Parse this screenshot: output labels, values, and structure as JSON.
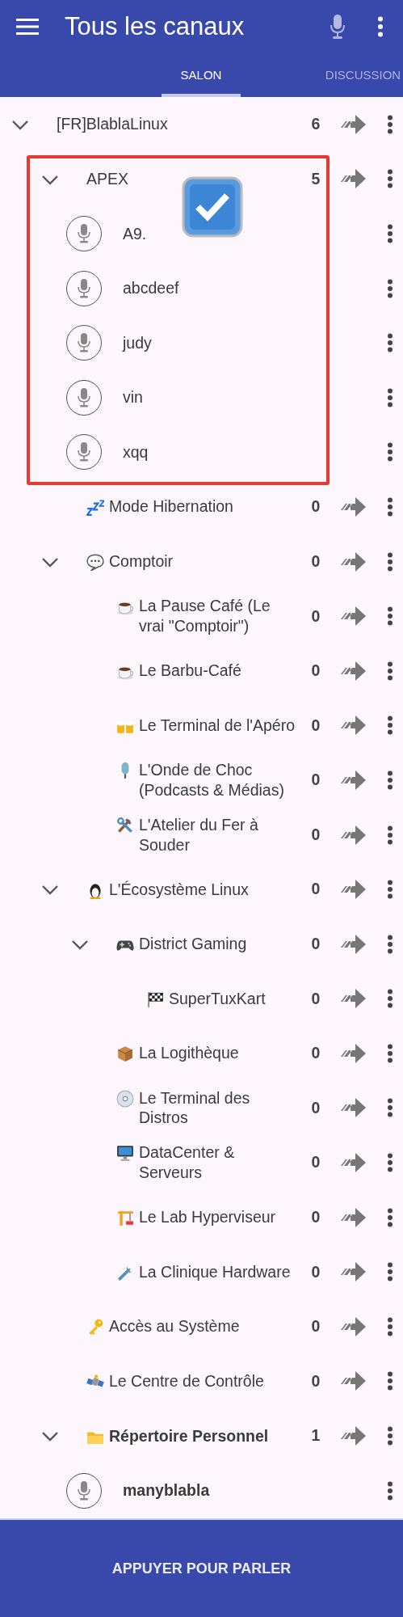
{
  "app_bar": {
    "title": "Tous les canaux",
    "mic_enabled": false
  },
  "tabs": [
    {
      "label": "SALON",
      "selected": true
    },
    {
      "label": "DISCUSSION",
      "selected": false
    }
  ],
  "channels": [
    {
      "kind": "channel",
      "name": "[FR]BlablaLinux",
      "count": "6",
      "expanded": true,
      "children": [
        {
          "kind": "channel",
          "name": "APEX",
          "count": "5",
          "expanded": true,
          "annotated": true,
          "children": [
            {
              "kind": "user",
              "name": "A9."
            },
            {
              "kind": "user",
              "name": "abcdeef"
            },
            {
              "kind": "user",
              "name": "judy"
            },
            {
              "kind": "user",
              "name": "vin"
            },
            {
              "kind": "user",
              "name": "xqq"
            }
          ]
        },
        {
          "kind": "channel",
          "name": "Mode Hibernation",
          "count": "0"
        },
        {
          "kind": "channel",
          "name": "Comptoir",
          "count": "0",
          "expanded": true,
          "children": [
            {
              "kind": "channel",
              "name": "La Pause Café (Le vrai \"Comptoir\")",
              "count": "0"
            },
            {
              "kind": "channel",
              "name": "Le Barbu-Café",
              "count": "0"
            },
            {
              "kind": "channel",
              "name": "Le Terminal de l'Apéro",
              "count": "0"
            },
            {
              "kind": "channel",
              "name": "L'Onde de Choc (Podcasts & Médias)",
              "count": "0"
            },
            {
              "kind": "channel",
              "name": "L'Atelier du Fer à Souder",
              "count": "0"
            }
          ]
        },
        {
          "kind": "channel",
          "name": "L'Écosystème Linux",
          "count": "0",
          "expanded": true,
          "children": [
            {
              "kind": "channel",
              "name": "District Gaming",
              "count": "0",
              "expanded": true,
              "children": [
                {
                  "kind": "channel",
                  "name": "SuperTuxKart",
                  "count": "0"
                }
              ]
            },
            {
              "kind": "channel",
              "name": "La Logithèque",
              "count": "0"
            },
            {
              "kind": "channel",
              "name": "Le Terminal des Distros",
              "count": "0"
            },
            {
              "kind": "channel",
              "name": "DataCenter & Serveurs",
              "count": "0"
            },
            {
              "kind": "channel",
              "name": "Le Lab Hyperviseur",
              "count": "0"
            },
            {
              "kind": "channel",
              "name": "La Clinique Hardware",
              "count": "0"
            }
          ]
        },
        {
          "kind": "channel",
          "name": "Accès au Système",
          "count": "0"
        },
        {
          "kind": "channel",
          "name": "Le Centre de Contrôle",
          "count": "0"
        },
        {
          "kind": "channel",
          "name": "Répertoire Personnel",
          "count": "1",
          "expanded": true,
          "highlighted": true,
          "children": [
            {
              "kind": "user",
              "name": "manyblabla",
              "current_user": true
            }
          ]
        }
      ]
    }
  ],
  "push_to_talk": {
    "label": "APPUYER POUR PARLER"
  }
}
